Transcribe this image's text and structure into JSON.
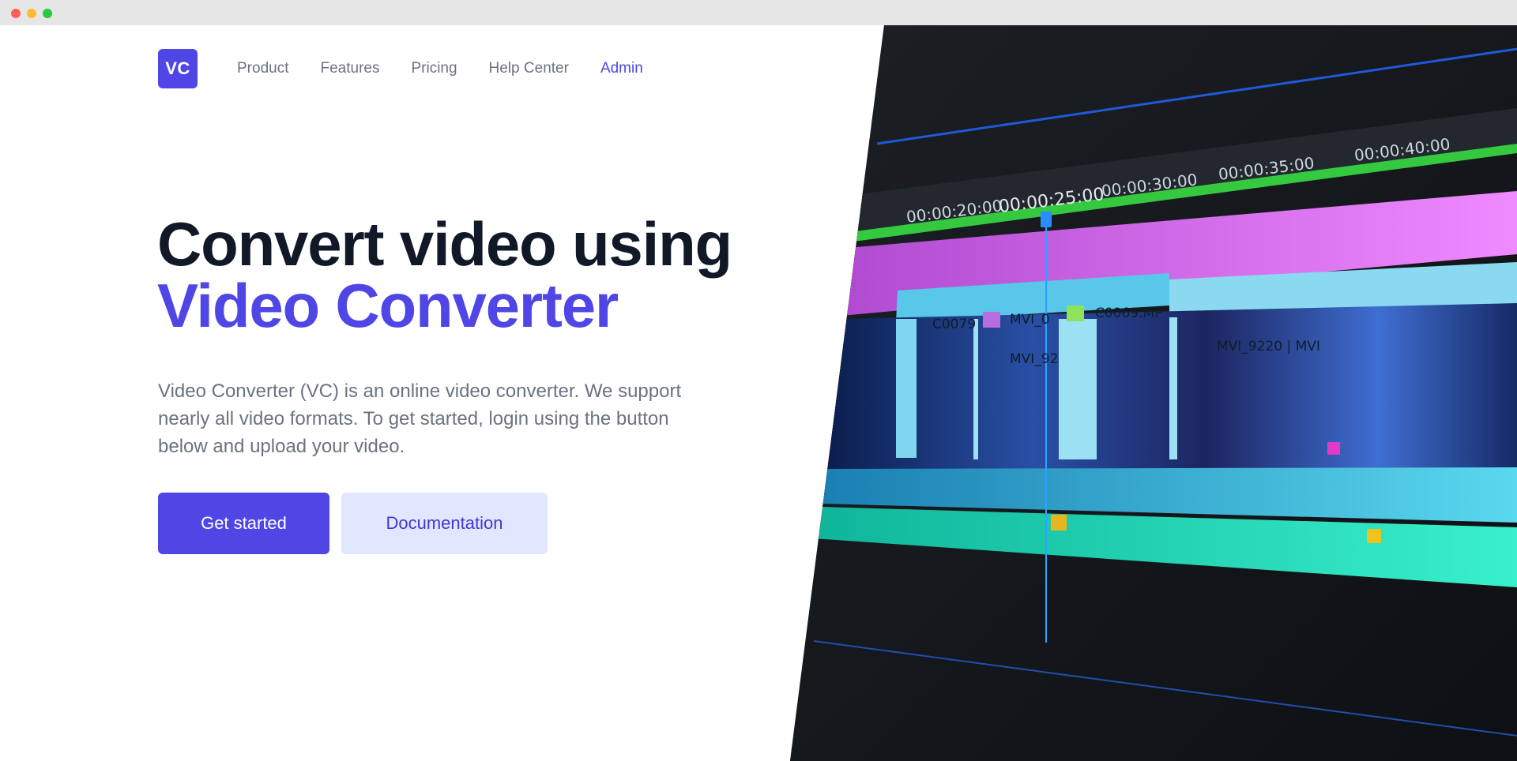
{
  "window": {
    "controls": [
      "close",
      "minimize",
      "maximize"
    ]
  },
  "brand": {
    "logo_text": "VC",
    "accent_color": "#4f46e5"
  },
  "nav": {
    "items": [
      {
        "label": "Product"
      },
      {
        "label": "Features"
      },
      {
        "label": "Pricing"
      },
      {
        "label": "Help Center"
      },
      {
        "label": "Admin"
      }
    ]
  },
  "hero": {
    "headline_line1": "Convert video using",
    "headline_line2": "Video Converter",
    "description": "Video Converter (VC) is an online video converter. We support nearly all video formats. To get started, login using the button below and upload your video.",
    "primary_button": "Get started",
    "secondary_button": "Documentation"
  },
  "timeline_image": {
    "timecodes": [
      "00:00:20:00",
      "00:00:25:00",
      "00:00:30:00",
      "00:00:35:00",
      "00:00:40:00"
    ],
    "clips": [
      "C0079",
      "MVI_0",
      "C0069.MP",
      "MVI_92",
      "MVI_9220 | MVI"
    ]
  }
}
